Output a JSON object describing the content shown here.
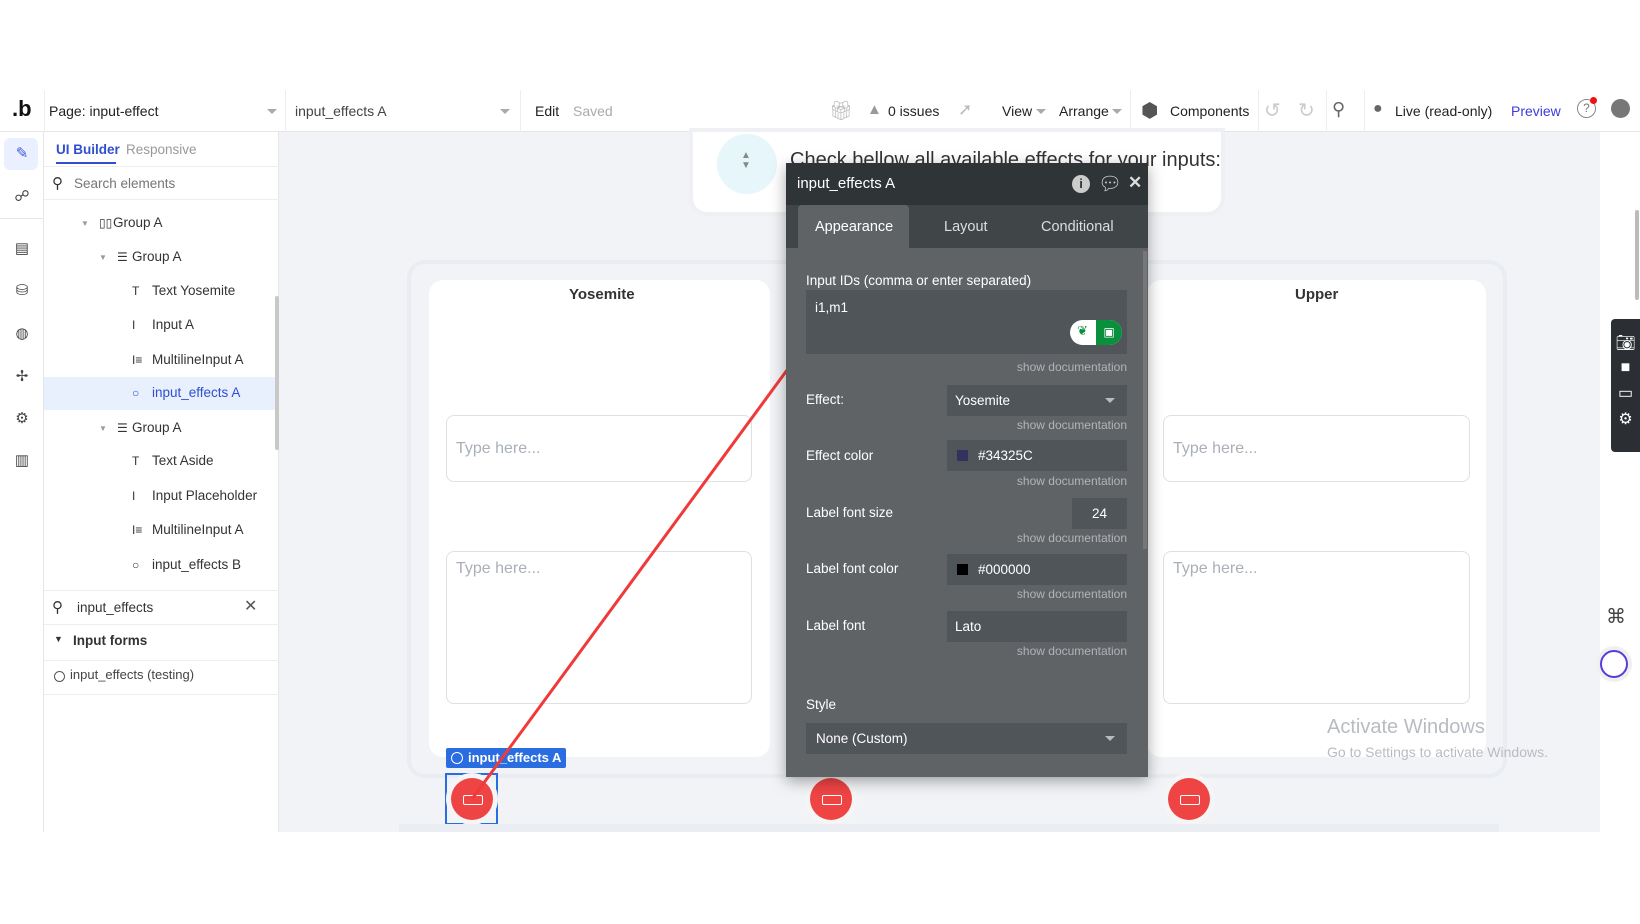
{
  "topbar": {
    "logo": ".b",
    "page": "Page: input-effect",
    "element": "input_effects A",
    "edit": "Edit",
    "saved": "Saved",
    "issues": "0 issues",
    "view": "View",
    "arrange": "Arrange",
    "components": "Components",
    "live": "Live (read-only)",
    "preview": "Preview"
  },
  "leftpanel": {
    "tab_builder": "UI Builder",
    "tab_responsive": "Responsive",
    "search_placeholder": "Search elements",
    "tree": [
      {
        "label": "Group A",
        "icon": "column-group-icon",
        "level": 0
      },
      {
        "label": "Group A",
        "icon": "row-group-icon",
        "level": 1
      },
      {
        "label": "Text Yosemite",
        "icon": "text-icon",
        "level": 2
      },
      {
        "label": "Input A",
        "icon": "input-icon",
        "level": 2
      },
      {
        "label": "MultilineInput A",
        "icon": "multiline-icon",
        "level": 2
      },
      {
        "label": "input_effects A",
        "icon": "plugin-circle-icon",
        "level": 2,
        "selected": true
      },
      {
        "label": "Group A",
        "icon": "row-group-icon",
        "level": 1
      },
      {
        "label": "Text Aside",
        "icon": "text-icon",
        "level": 2
      },
      {
        "label": "Input Placeholder",
        "icon": "input-icon",
        "level": 2
      },
      {
        "label": "MultilineInput A",
        "icon": "multiline-icon",
        "level": 2
      },
      {
        "label": "input_effects B",
        "icon": "plugin-circle-icon",
        "level": 2
      }
    ],
    "search2_value": "input_effects",
    "section": "Input forms",
    "result": "input_effects (testing)"
  },
  "canvas": {
    "heading": "Check bellow all available effects for your inputs:",
    "card1_title": "Yosemite",
    "card3_title": "Upper",
    "placeholder": "Type here...",
    "selected_tag": "input_effects A",
    "watermark_title": "Activate Windows",
    "watermark_sub": "Go to Settings to activate Windows."
  },
  "panel": {
    "title": "input_effects A",
    "tabs": [
      "Appearance",
      "Layout",
      "Conditional"
    ],
    "active_tab": "Appearance",
    "ids_label": "Input IDs (comma or enter separated)",
    "ids_value": "i1,m1",
    "doc": "show documentation",
    "effect_label": "Effect:",
    "effect_value": "Yosemite",
    "color_label": "Effect color",
    "color_value": "#34325C",
    "size_label": "Label font size",
    "size_value": "24",
    "fcolor_label": "Label font color",
    "fcolor_value": "#000000",
    "font_label": "Label font",
    "font_value": "Lato",
    "style_label": "Style",
    "style_value": "None (Custom)"
  },
  "colors": {
    "accent": "#3b5bdb",
    "arrow": "#f03a3a",
    "effect": "#34325C",
    "red_button": "#ef4444"
  }
}
